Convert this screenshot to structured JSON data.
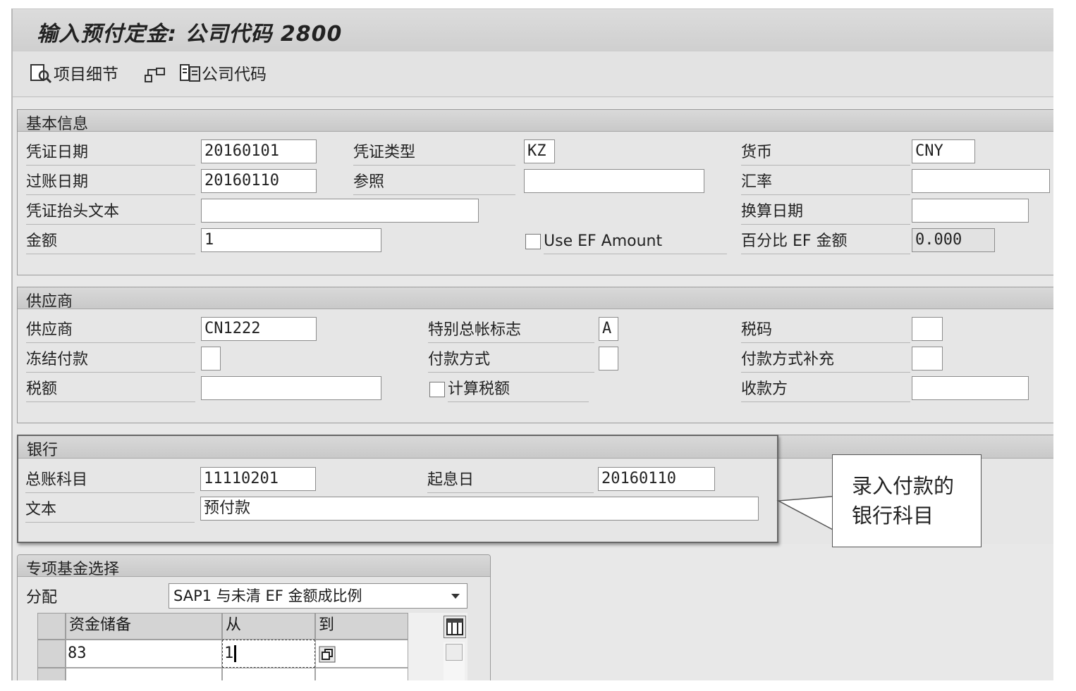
{
  "window": {
    "title": "输入预付定金: 公司代码 2800"
  },
  "toolbar": {
    "item_detail": "项目细节",
    "company_code": "公司代码"
  },
  "basic": {
    "header": "基本信息",
    "doc_date_label": "凭证日期",
    "doc_date": "20160101",
    "doc_type_label": "凭证类型",
    "doc_type": "KZ",
    "currency_label": "货币",
    "currency": "CNY",
    "posting_date_label": "过账日期",
    "posting_date": "20160110",
    "reference_label": "参照",
    "reference": "",
    "exchange_rate_label": "汇率",
    "exchange_rate": "",
    "header_text_label": "凭证抬头文本",
    "header_text": "",
    "translation_date_label": "换算日期",
    "translation_date": "",
    "amount_label": "金额",
    "amount": "1",
    "use_ef_amount_label": "Use EF Amount",
    "percent_ef_label": "百分比 EF 金额",
    "percent_ef": "0.000"
  },
  "vendor": {
    "header": "供应商",
    "vendor_label": "供应商",
    "vendor": "CN1222",
    "special_gl_label": "特别总帐标志",
    "special_gl": "A",
    "tax_code_label": "税码",
    "tax_code": "",
    "payment_block_label": "冻结付款",
    "payment_block": "",
    "payment_method_label": "付款方式",
    "payment_method": "",
    "pmt_method_supplement_label": "付款方式补充",
    "pmt_method_supplement": "",
    "tax_amount_label": "税额",
    "tax_amount": "",
    "calc_tax_label": "计算税额",
    "payee_label": "收款方",
    "payee": ""
  },
  "bank": {
    "header": "银行",
    "gl_account_label": "总账科目",
    "gl_account": "11110201",
    "value_date_label": "起息日",
    "value_date": "20160110",
    "text_label": "文本",
    "text": "预付款"
  },
  "callout": {
    "text": "录入付款的银行科目"
  },
  "earmarked": {
    "header": "专项基金选择",
    "distribution_label": "分配",
    "distribution_value": "SAP1 与未清 EF 金额成比例",
    "columns": [
      "资金储备",
      "从",
      "到"
    ],
    "rows": [
      {
        "reserve": "83",
        "from": "1",
        "to": ""
      }
    ]
  }
}
